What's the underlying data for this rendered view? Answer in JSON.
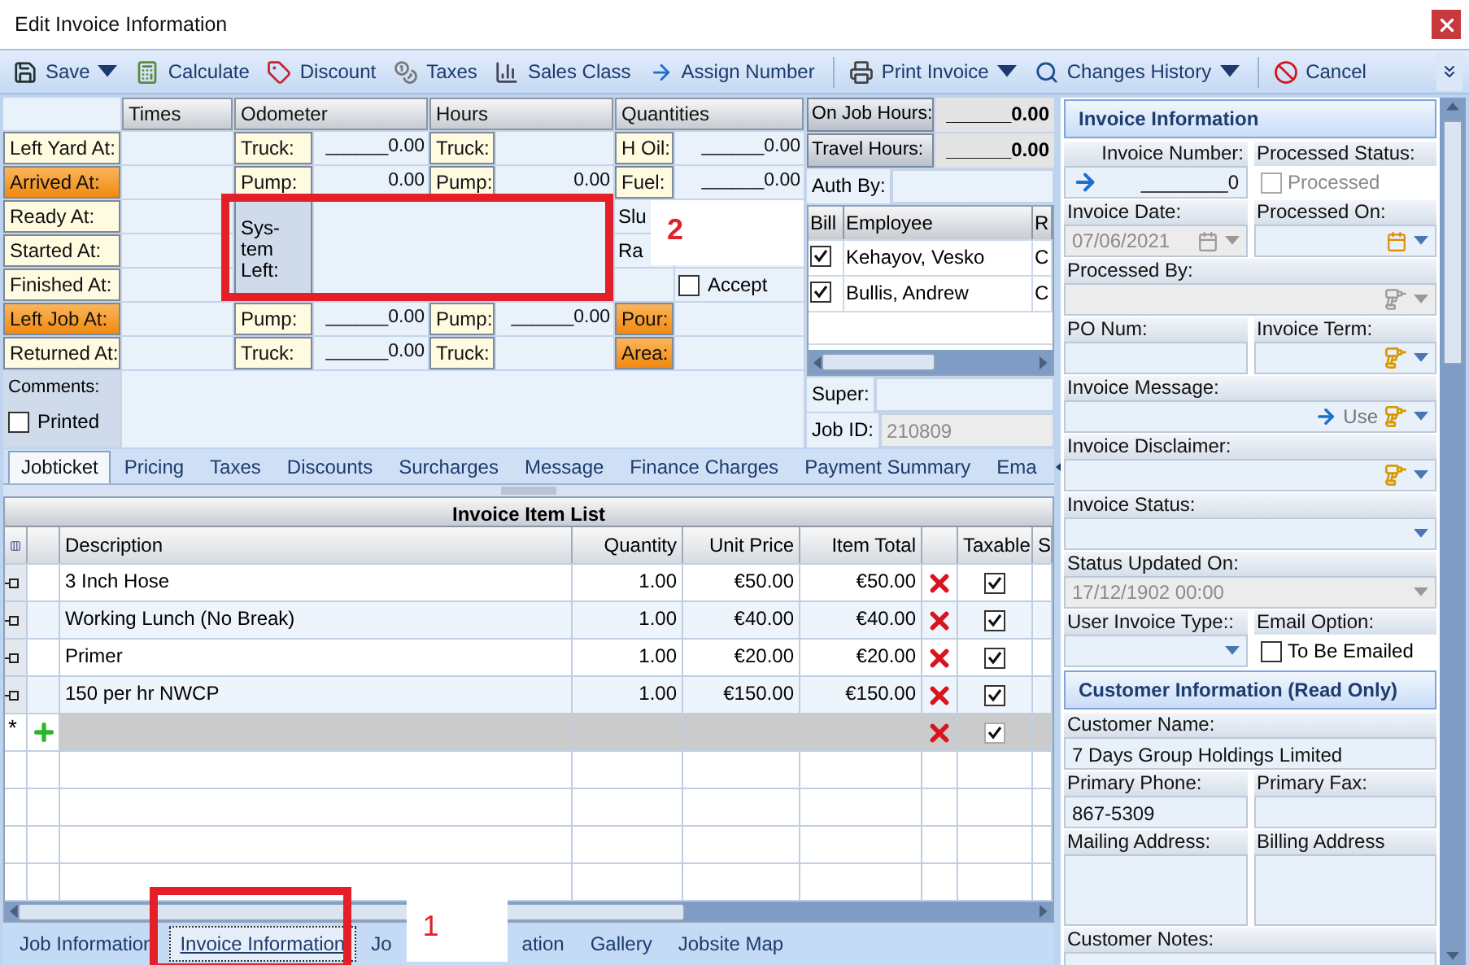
{
  "window": {
    "title": "Edit Invoice Information"
  },
  "toolbar": [
    {
      "kind": "save",
      "label": "Save",
      "menu": true,
      "separator_before": false
    },
    {
      "kind": "calculate",
      "label": "Calculate",
      "menu": false,
      "separator_before": false
    },
    {
      "kind": "discount",
      "label": "Discount",
      "menu": false,
      "separator_before": false
    },
    {
      "kind": "taxes",
      "label": "Taxes",
      "menu": false,
      "separator_before": false
    },
    {
      "kind": "sales_class",
      "label": "Sales Class",
      "menu": false,
      "separator_before": false
    },
    {
      "kind": "assign",
      "label": "Assign Number",
      "menu": false,
      "separator_before": false
    },
    {
      "kind": "print",
      "label": "Print Invoice",
      "menu": true,
      "separator_before": true
    },
    {
      "kind": "history",
      "label": "Changes History",
      "menu": true,
      "separator_before": false
    },
    {
      "kind": "cancel",
      "label": "Cancel",
      "menu": false,
      "separator_before": true
    }
  ],
  "form": {
    "headers": [
      "Times",
      "Odometer",
      "Hours",
      "Quantities"
    ],
    "rows": [
      {
        "label": "Left Yard At:",
        "highlight": false,
        "odometer": {
          "label": "Truck:",
          "value": "______0.00"
        },
        "hours": {
          "label": "Truck:"
        },
        "quantity": {
          "kind": "field",
          "label": "H Oil:",
          "value": "______0.00",
          "highlight": false
        }
      },
      {
        "label": "Arrived At:",
        "highlight": true,
        "odometer": {
          "label": "Pump:",
          "value": "0.00"
        },
        "hours": {
          "label": "Pump:",
          "value": "0.00"
        },
        "quantity": {
          "kind": "field",
          "label": "Fuel:",
          "value": "______0.00",
          "highlight": false
        }
      },
      {
        "label": "Ready At:",
        "highlight": false,
        "quantity": {
          "kind": "label",
          "label": "Slu"
        }
      },
      {
        "label": "Started At:",
        "highlight": false,
        "quantity": {
          "kind": "label",
          "label": "Ra"
        }
      },
      {
        "label": "Finished At:",
        "highlight": false,
        "quantity": {
          "kind": "checkbox",
          "label": "Accept",
          "checked": false
        }
      },
      {
        "label": "Left Job At:",
        "highlight": true,
        "odometer": {
          "label": "Pump:",
          "value": "______0.00"
        },
        "hours": {
          "label": "Pump:",
          "value": "______0.00"
        },
        "quantity": {
          "kind": "field",
          "label": "Pour:",
          "highlight": true
        }
      },
      {
        "label": "Returned At:",
        "highlight": false,
        "odometer": {
          "label": "Truck:",
          "value": "______0.00"
        },
        "hours": {
          "label": "Truck:"
        },
        "quantity": {
          "kind": "field",
          "label": "Area:",
          "highlight": true
        }
      }
    ],
    "system_left": {
      "label": "Sys-tem Left:"
    },
    "comments": {
      "label": "Comments:"
    },
    "printed": {
      "label": "Printed",
      "checked": false
    }
  },
  "hours_summary": [
    {
      "label": "On Job Hours:",
      "value": "______0.00"
    },
    {
      "label": "Travel Hours:",
      "value": "______0.00"
    }
  ],
  "auth_by": {
    "label": "Auth By:"
  },
  "employees": {
    "columns": [
      "Bill",
      "Employee",
      "R"
    ],
    "rows": [
      {
        "bill": true,
        "name": "Kehayov, Vesko",
        "column_3": "C"
      },
      {
        "bill": true,
        "name": "Bullis, Andrew",
        "column_3": "C"
      }
    ]
  },
  "super": {
    "label": "Super:"
  },
  "job_id": {
    "label": "Job ID:",
    "value": "210809"
  },
  "tabs": [
    {
      "label": "Jobticket",
      "selected": true
    },
    {
      "label": "Pricing",
      "selected": false
    },
    {
      "label": "Taxes",
      "selected": false
    },
    {
      "label": "Discounts",
      "selected": false
    },
    {
      "label": "Surcharges",
      "selected": false
    },
    {
      "label": "Message",
      "selected": false
    },
    {
      "label": "Finance Charges",
      "selected": false
    },
    {
      "label": "Payment Summary",
      "selected": false
    },
    {
      "label": "Ema",
      "selected": false
    }
  ],
  "item_list": {
    "title": "Invoice Item List",
    "columns": [
      "Description",
      "Quantity",
      "Unit Price",
      "Item Total",
      "Taxable",
      "S"
    ],
    "rows": [
      {
        "description": "3 Inch Hose",
        "quantity": "1.00",
        "unit_price": "€50.00",
        "item_total": "€50.00",
        "taxable": true
      },
      {
        "description": "Working Lunch (No Break)",
        "quantity": "1.00",
        "unit_price": "€40.00",
        "item_total": "€40.00",
        "taxable": true
      },
      {
        "description": "Primer",
        "quantity": "1.00",
        "unit_price": "€20.00",
        "item_total": "€20.00",
        "taxable": true
      },
      {
        "description": "150 per hr NWCP",
        "quantity": "1.00",
        "unit_price": "€150.00",
        "item_total": "€150.00",
        "taxable": true
      }
    ],
    "new_row": {
      "marker": "*",
      "taxable": true
    }
  },
  "bottom_tabs": [
    {
      "label": "Job Information",
      "selected": false
    },
    {
      "label": "Invoice Information",
      "selected": true
    },
    {
      "label": "Jo",
      "label_end": "ation",
      "selected": false
    },
    {
      "label": "Gallery",
      "selected": false
    },
    {
      "label": "Jobsite Map",
      "selected": false
    }
  ],
  "invoice_info": {
    "title": "Invoice Information",
    "invoice_number": {
      "label": "Invoice Number:",
      "value": "________0"
    },
    "processed_status": {
      "label": "Processed Status:",
      "checkbox_label": "Processed",
      "checked": false,
      "disabled": true
    },
    "invoice_date": {
      "label": "Invoice Date:",
      "value": "07/06/2021",
      "disabled": true
    },
    "processed_on": {
      "label": "Processed On:"
    },
    "processed_by": {
      "label": "Processed By:",
      "disabled": true
    },
    "po_num": {
      "label": "PO Num:"
    },
    "invoice_term": {
      "label": "Invoice Term:"
    },
    "invoice_message": {
      "label": "Invoice Message:",
      "action": "Use"
    },
    "invoice_disclaimer": {
      "label": "Invoice Disclaimer:"
    },
    "invoice_status": {
      "label": "Invoice Status:"
    },
    "status_updated_on": {
      "label": "Status Updated On:",
      "value": "17/12/1902 00:00",
      "disabled": true
    },
    "user_invoice_type": {
      "label": "User Invoice Type::"
    },
    "email_option": {
      "label": "Email Option:",
      "checkbox_label": "To Be Emailed",
      "checked": false
    }
  },
  "customer_info": {
    "title": "Customer Information (Read Only)",
    "fields": [
      {
        "kind": "wide",
        "label": "Customer Name:",
        "value": "7 Days Group Holdings Limited"
      },
      {
        "kind": "half",
        "label": "Primary Phone:",
        "value": "867-5309"
      },
      {
        "kind": "half",
        "label": "Primary Fax:"
      },
      {
        "kind": "tall",
        "label": "Mailing Address:"
      },
      {
        "kind": "tall",
        "label": "Billing Address"
      },
      {
        "kind": "wide",
        "label": "Customer Notes:"
      }
    ]
  },
  "annotations": [
    {
      "label": "2"
    },
    {
      "label": "1"
    }
  ]
}
